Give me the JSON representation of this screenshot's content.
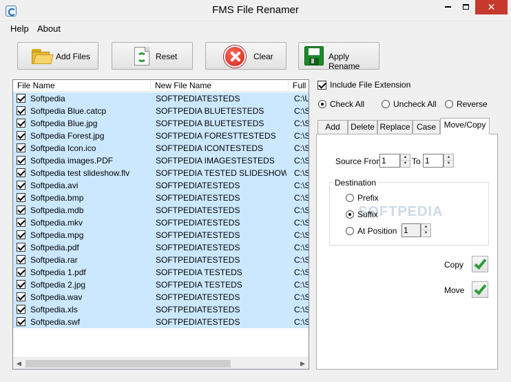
{
  "window": {
    "title": "FMS File Renamer"
  },
  "menu": {
    "help": "Help",
    "about": "About"
  },
  "toolbar": {
    "add_files": "Add Files",
    "reset": "Reset",
    "clear": "Clear",
    "apply_rename": "Apply Rename"
  },
  "list": {
    "columns": [
      "File Name",
      "New File Name",
      "Full P"
    ],
    "rows": [
      [
        "Softpedia",
        "SOFTPEDIATESTEDS",
        "C:\\U"
      ],
      [
        "Softpedia Blue.catcp",
        "SOFTPEDIA BLUETESTEDS",
        "C:\\S"
      ],
      [
        "Softpedia Blue.jpg",
        "SOFTPEDIA BLUETESTEDS",
        "C:\\S"
      ],
      [
        "Softpedia Forest.jpg",
        "SOFTPEDIA FORESTTESTEDS",
        "C:\\S"
      ],
      [
        "Softpedia Icon.ico",
        "SOFTPEDIA ICONTESTEDS",
        "C:\\S"
      ],
      [
        "Softpedia images.PDF",
        "SOFTPEDIA IMAGESTESTEDS",
        "C:\\S"
      ],
      [
        "Softpedia test slideshow.flv",
        "SOFTPEDIA TESTED SLIDESHOW...",
        "C:\\S"
      ],
      [
        "Softpedia.avi",
        "SOFTPEDIATESTEDS",
        "C:\\S"
      ],
      [
        "Softpedia.bmp",
        "SOFTPEDIATESTEDS",
        "C:\\S"
      ],
      [
        "Softpedia.mdb",
        "SOFTPEDIATESTEDS",
        "C:\\S"
      ],
      [
        "Softpedia.mkv",
        "SOFTPEDIATESTEDS",
        "C:\\S"
      ],
      [
        "Softpedia.mpg",
        "SOFTPEDIATESTEDS",
        "C:\\S"
      ],
      [
        "Softpedia.pdf",
        "SOFTPEDIATESTEDS",
        "C:\\S"
      ],
      [
        "Softpedia.rar",
        "SOFTPEDIATESTEDS",
        "C:\\S"
      ],
      [
        "Softpedia 1.pdf",
        "SOFTPEDIA TESTEDS",
        "C:\\S"
      ],
      [
        "Softpedia 2.jpg",
        "SOFTPEDIA TESTEDS",
        "C:\\S"
      ],
      [
        "Softpedia.wav",
        "SOFTPEDIATESTEDS",
        "C:\\S"
      ],
      [
        "Softpedia.xls",
        "SOFTPEDIATESTEDS",
        "C:\\S"
      ],
      [
        "Softpedia.swf",
        "SOFTPEDIATESTEDS",
        "C:\\S"
      ]
    ]
  },
  "options": {
    "include_extension": "Include File Extension",
    "check_all": "Check All",
    "uncheck_all": "Uncheck All",
    "reverse": "Reverse"
  },
  "tabs": [
    "Add",
    "Delete",
    "Replace",
    "Case",
    "Move/Copy"
  ],
  "movecopy": {
    "source_from_label": "Source From",
    "source_from_value": "1",
    "to_label": "To",
    "to_value": "1",
    "destination_label": "Destination",
    "prefix": "Prefix",
    "suffix": "Suffix",
    "at_position": "At Position",
    "position_value": "1",
    "copy": "Copy",
    "move": "Move"
  },
  "watermark": "SOFTPEDIA",
  "colors": {
    "selection": "#cce8ff",
    "close_button": "#c7392c",
    "check_green": "#2e9d3b"
  }
}
